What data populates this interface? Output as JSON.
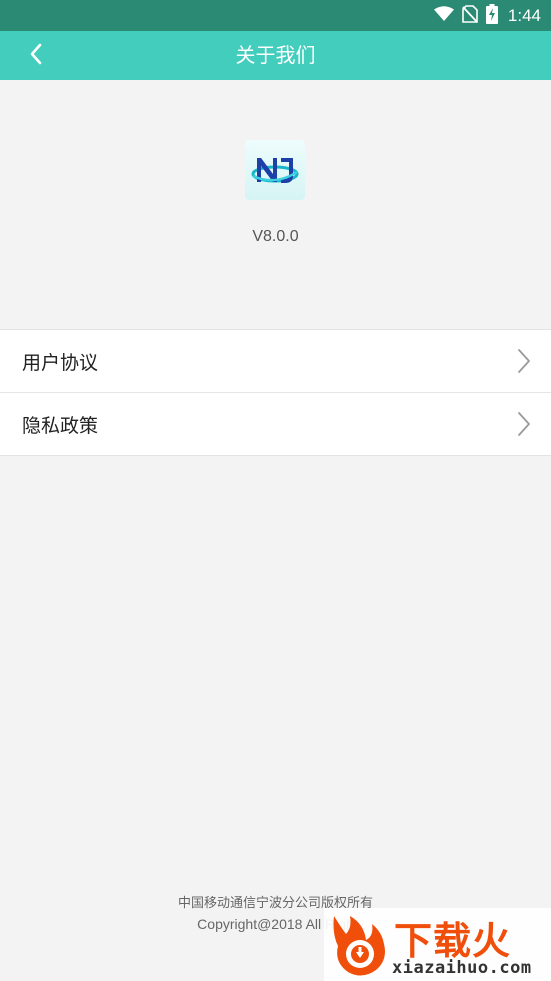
{
  "status_bar": {
    "time": "1:44",
    "icons": [
      "wifi-icon",
      "no-sim-icon",
      "battery-charging-icon"
    ]
  },
  "app_bar": {
    "title": "关于我们",
    "back_icon": "chevron-left-icon"
  },
  "about": {
    "version": "V8.0.0"
  },
  "menu": {
    "items": [
      {
        "label": "用户协议"
      },
      {
        "label": "隐私政策"
      }
    ]
  },
  "footer": {
    "company": "中国移动通信宁波分公司版权所有",
    "copyright": "Copyright@2018  All  Righ"
  },
  "watermark": {
    "brand": "下载火",
    "domain": "xiazaihuo.com"
  },
  "colors": {
    "app_bar": "#43cdbd",
    "status_bar": "#2a8a74",
    "background": "#f3f3f3",
    "watermark_accent": "#f04e0b"
  }
}
